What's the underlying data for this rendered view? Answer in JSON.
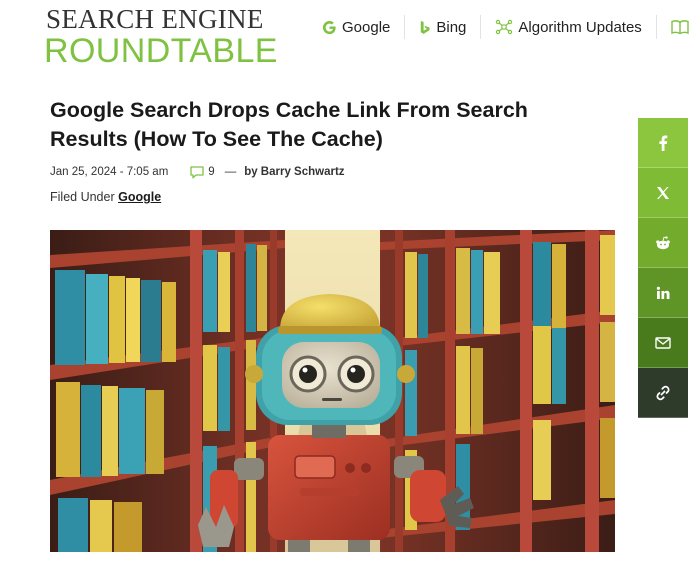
{
  "logo": {
    "line1": "SEARCH ENGINE",
    "line2": "ROUNDTABLE"
  },
  "nav": {
    "items": [
      {
        "label": "Google",
        "icon": "google-g-icon"
      },
      {
        "label": "Bing",
        "icon": "bing-b-icon"
      },
      {
        "label": "Algorithm Updates",
        "icon": "network-icon"
      },
      {
        "label": "",
        "icon": "book-icon"
      }
    ]
  },
  "article": {
    "title": "Google Search Drops Cache Link From Search Results (How To See The Cache)",
    "date": "Jan 25, 2024 - 7:05 am",
    "comments_count": "9",
    "dash": "—",
    "author": "by Barry Schwartz",
    "filed_label": "Filed Under",
    "filed_category": "Google"
  },
  "share": {
    "buttons": [
      {
        "icon": "facebook-icon",
        "color": "#8cc63f"
      },
      {
        "icon": "x-twitter-icon",
        "color": "#7fbb34"
      },
      {
        "icon": "reddit-icon",
        "color": "#73ac2d"
      },
      {
        "icon": "linkedin-icon",
        "color": "#5f9426"
      },
      {
        "icon": "email-icon",
        "color": "#497a1c"
      },
      {
        "icon": "link-icon",
        "color": "#2e3a2a"
      }
    ]
  },
  "colors": {
    "brand_green": "#7fc241",
    "text_dark": "#1a1a1a"
  }
}
